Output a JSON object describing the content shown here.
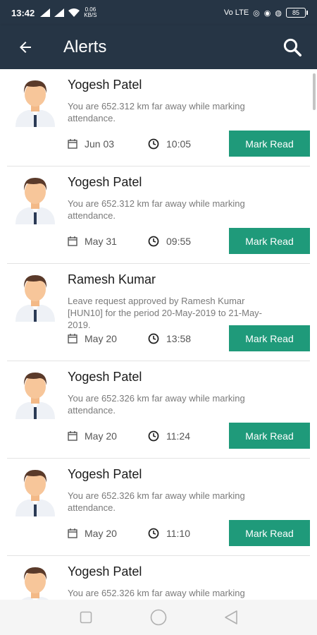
{
  "status_bar": {
    "time": "13:42",
    "network_speed_value": "0.06",
    "network_speed_unit": "KB/S",
    "battery": "85",
    "volte_label": "Vo LTE"
  },
  "app_bar": {
    "title": "Alerts"
  },
  "alerts": [
    {
      "name": "Yogesh Patel",
      "message": "You are 652.312 km far away while marking attendance.",
      "date": "Jun 03",
      "time": "10:05",
      "button": "Mark Read"
    },
    {
      "name": "Yogesh Patel",
      "message": "You are 652.312 km far away while marking attendance.",
      "date": "May 31",
      "time": "09:55",
      "button": "Mark Read"
    },
    {
      "name": "Ramesh Kumar",
      "message": "Leave request approved by Ramesh Kumar [HUN10] for the period 20-May-2019 to 21-May-2019.",
      "date": "May 20",
      "time": "13:58",
      "button": "Mark Read"
    },
    {
      "name": "Yogesh Patel",
      "message": "You are 652.326 km far away while marking attendance.",
      "date": "May 20",
      "time": "11:24",
      "button": "Mark Read"
    },
    {
      "name": "Yogesh Patel",
      "message": "You are 652.326 km far away while marking attendance.",
      "date": "May 20",
      "time": "11:10",
      "button": "Mark Read"
    },
    {
      "name": "Yogesh Patel",
      "message": "You are 652.326 km far away while marking",
      "date": "",
      "time": "",
      "button": ""
    }
  ],
  "colors": {
    "header": "#263545",
    "accent": "#1f9a7a"
  },
  "icons": {
    "back": "arrow-left-icon",
    "search": "search-icon",
    "date": "calendar-icon",
    "time": "clock-icon"
  }
}
